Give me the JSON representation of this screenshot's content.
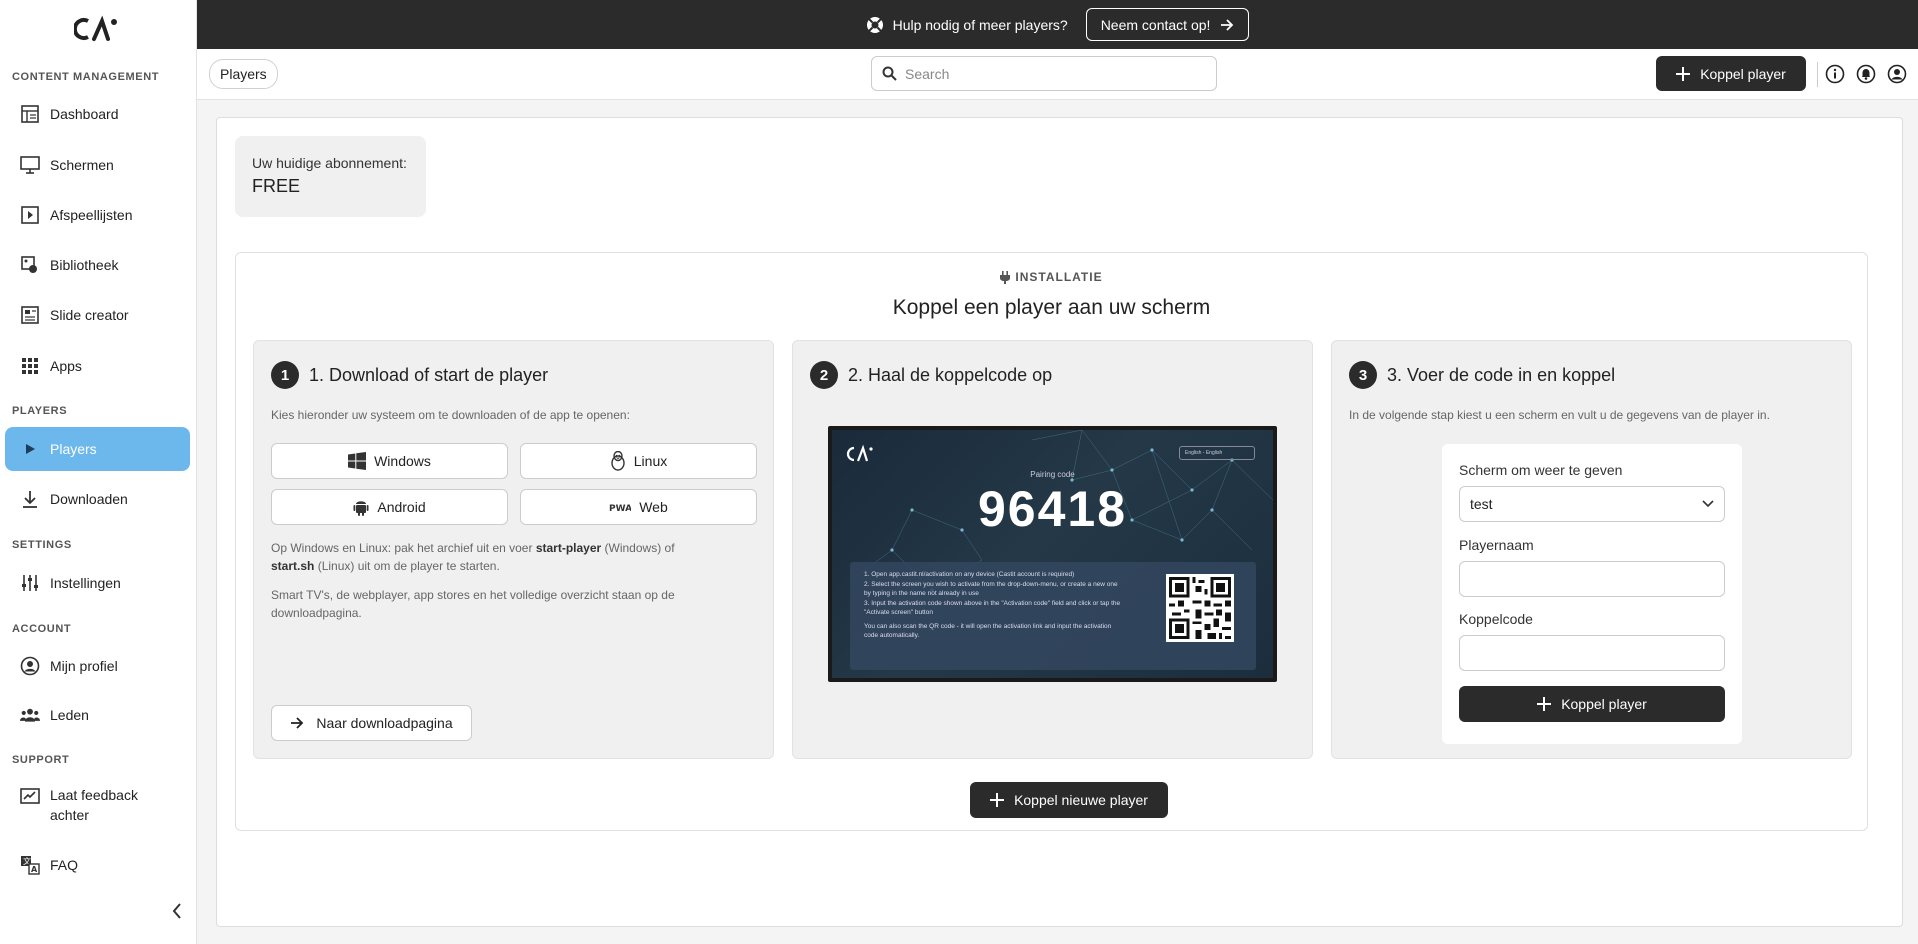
{
  "banner": {
    "text": "Hulp nodig of meer players?",
    "button": "Neem contact op!"
  },
  "sidebar": {
    "sections": {
      "content": "CONTENT MANAGEMENT",
      "players": "PLAYERS",
      "settings": "SETTINGS",
      "account": "ACCOUNT",
      "support": "SUPPORT"
    },
    "items": [
      {
        "label": "Dashboard",
        "icon": "dashboard-icon"
      },
      {
        "label": "Schermen",
        "icon": "monitor-icon"
      },
      {
        "label": "Afspeellijsten",
        "icon": "playlist-icon"
      },
      {
        "label": "Bibliotheek",
        "icon": "library-icon"
      },
      {
        "label": "Slide creator",
        "icon": "slide-creator-icon"
      },
      {
        "label": "Apps",
        "icon": "apps-grid-icon"
      },
      {
        "label": "Players",
        "icon": "play-icon",
        "active": true
      },
      {
        "label": "Downloaden",
        "icon": "download-icon"
      },
      {
        "label": "Instellingen",
        "icon": "sliders-icon"
      },
      {
        "label": "Mijn profiel",
        "icon": "profile-icon"
      },
      {
        "label": "Leden",
        "icon": "members-icon"
      },
      {
        "label": "Laat feedback achter",
        "icon": "feedback-icon"
      },
      {
        "label": "FAQ",
        "icon": "translate-icon"
      }
    ]
  },
  "header": {
    "breadcrumb": "Players",
    "search_placeholder": "Search",
    "koppel_button": "Koppel player"
  },
  "subscription": {
    "label": "Uw huidige abonnement:",
    "value": "FREE"
  },
  "installatie": {
    "kicker": "INSTALLATIE",
    "title": "Koppel een player aan uw scherm",
    "step1": {
      "number": "1",
      "title": "1. Download of start de player",
      "desc": "Kies hieronder uw systeem om te downloaden of de app te openen:",
      "os": [
        "Windows",
        "Linux",
        "Android",
        "Web"
      ],
      "note1_a": "Op Windows en Linux: pak het archief uit en voer ",
      "note1_b": "start-player",
      "note1_c": " (Windows) of ",
      "note1_d": "start.sh",
      "note1_e": " (Linux) uit om de player te starten.",
      "note2": "Smart TV's, de webplayer, app stores en het volledige overzicht staan op de downloadpagina.",
      "download_button": "Naar downloadpagina"
    },
    "step2": {
      "number": "2",
      "title": "2. Haal de koppelcode op",
      "screen": {
        "pairing_label": "Pairing code",
        "code": "96418",
        "language": "English - English",
        "instructions": [
          "Open app.castit.nl/activation on any device (Castit account is required)",
          "Select the screen you wish to activate from the drop-down-menu, or create a new one by typing in the name not already in use",
          "Input the activation code shown above in the \"Activation code\" field and click or tap the \"Activate screen\" button"
        ],
        "qr_note": "You can also scan the QR code - it will open the activation link and input the activation code automatically."
      }
    },
    "step3": {
      "number": "3",
      "title": "3. Voer de code in en koppel",
      "desc": "In de volgende stap kiest u een scherm en vult u de gegevens van de player in.",
      "form": {
        "screen_label": "Scherm om weer te geven",
        "screen_value": "test",
        "playername_label": "Playernaam",
        "playername_value": "",
        "code_label": "Koppelcode",
        "code_value": "",
        "submit": "Koppel player"
      }
    },
    "new_button": "Koppel nieuwe player"
  }
}
